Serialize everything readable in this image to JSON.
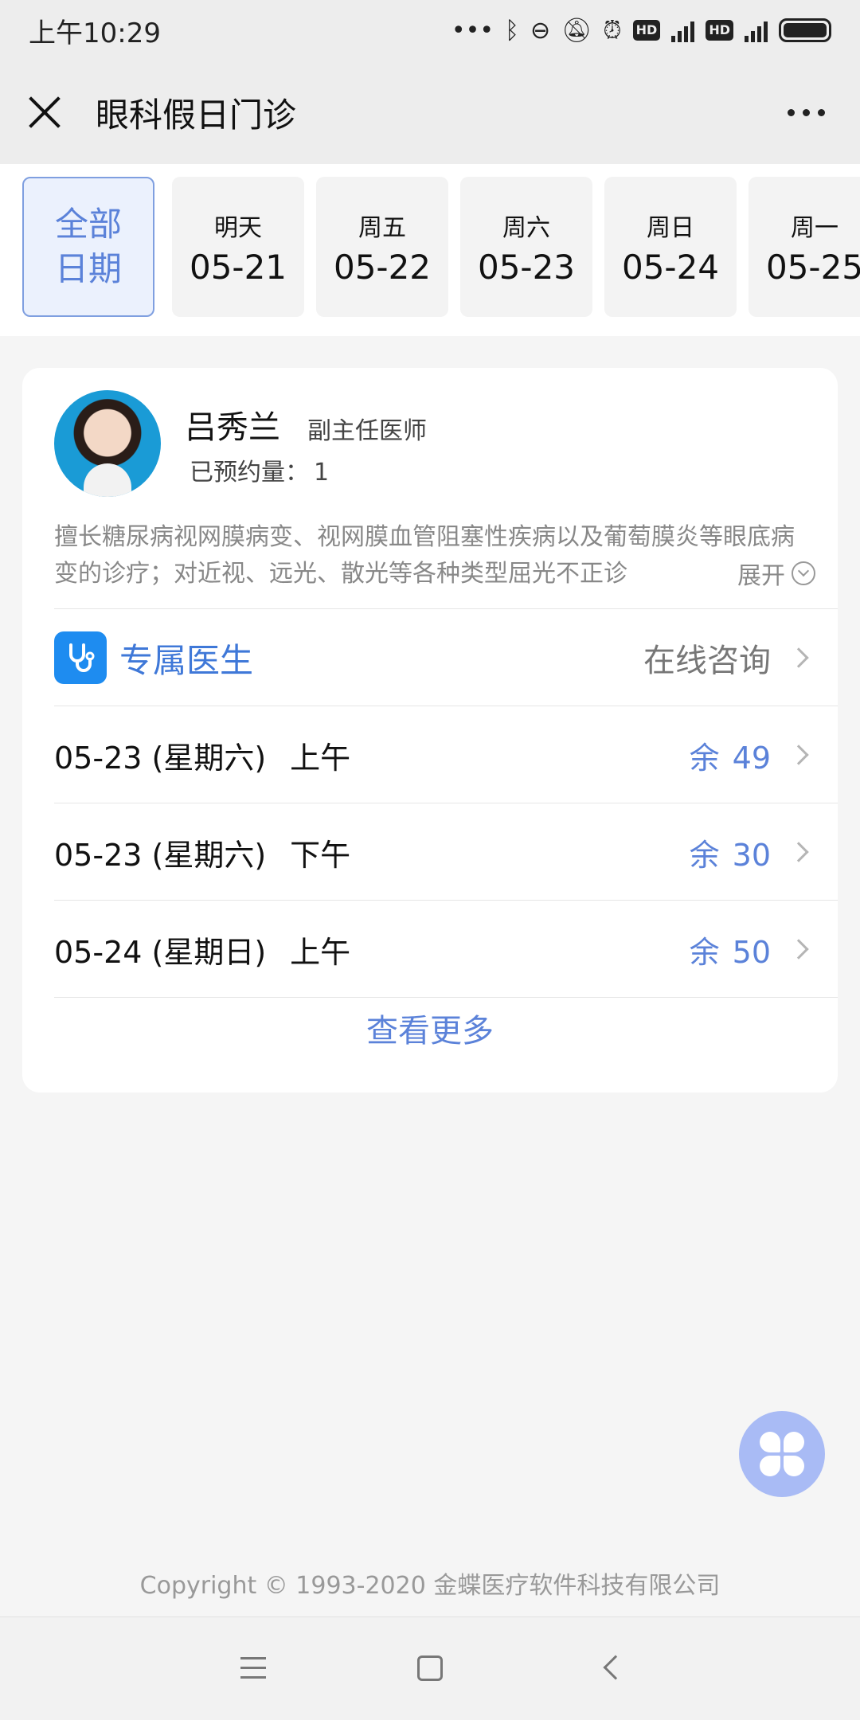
{
  "status_bar": {
    "time": "上午10:29",
    "icons": [
      "more-dots-icon",
      "bluetooth-icon",
      "toggle-icon",
      "mute-bell-icon",
      "alarm-icon",
      "hd-badge",
      "signal-4g-icon",
      "hd-badge",
      "signal-4g-icon",
      "battery-icon"
    ],
    "hd_label": "HD",
    "net_label": "4G"
  },
  "nav": {
    "title": "眼科假日门诊"
  },
  "date_tabs": [
    {
      "label": "全部\n日期",
      "active": true
    },
    {
      "weekday": "明天",
      "date": "05-21"
    },
    {
      "weekday": "周五",
      "date": "05-22"
    },
    {
      "weekday": "周六",
      "date": "05-23"
    },
    {
      "weekday": "周日",
      "date": "05-24"
    },
    {
      "weekday": "周一",
      "date": "05-25"
    }
  ],
  "all_dates_label_1": "全部",
  "all_dates_label_2": "日期",
  "doctor": {
    "name": "吕秀兰",
    "title": "副主任医师",
    "booked_label": "已预约量：",
    "booked_count": "1",
    "description": "擅长糖尿病视网膜病变、视网膜血管阻塞性疾病以及葡萄膜炎等眼底病变的诊疗；对近视、远光、散光等各种类型屈光不正诊",
    "expand_label": "展开"
  },
  "exclusive": {
    "label": "专属医生",
    "action": "在线咨询"
  },
  "slots": [
    {
      "date": "05-23 (星期六)",
      "period": "上午",
      "remain_label": "余",
      "remain": "49"
    },
    {
      "date": "05-23 (星期六)",
      "period": "下午",
      "remain_label": "余",
      "remain": "30"
    },
    {
      "date": "05-24 (星期日)",
      "period": "上午",
      "remain_label": "余",
      "remain": "50"
    }
  ],
  "more_label": "查看更多",
  "copyright": "Copyright © 1993-2020 金蝶医疗软件科技有限公司",
  "colors": {
    "accent": "#5b82d9",
    "exclusive_icon_bg": "#1e8cf0",
    "fab_bg": "#a9bbf5",
    "page_bg": "#f5f5f5"
  }
}
